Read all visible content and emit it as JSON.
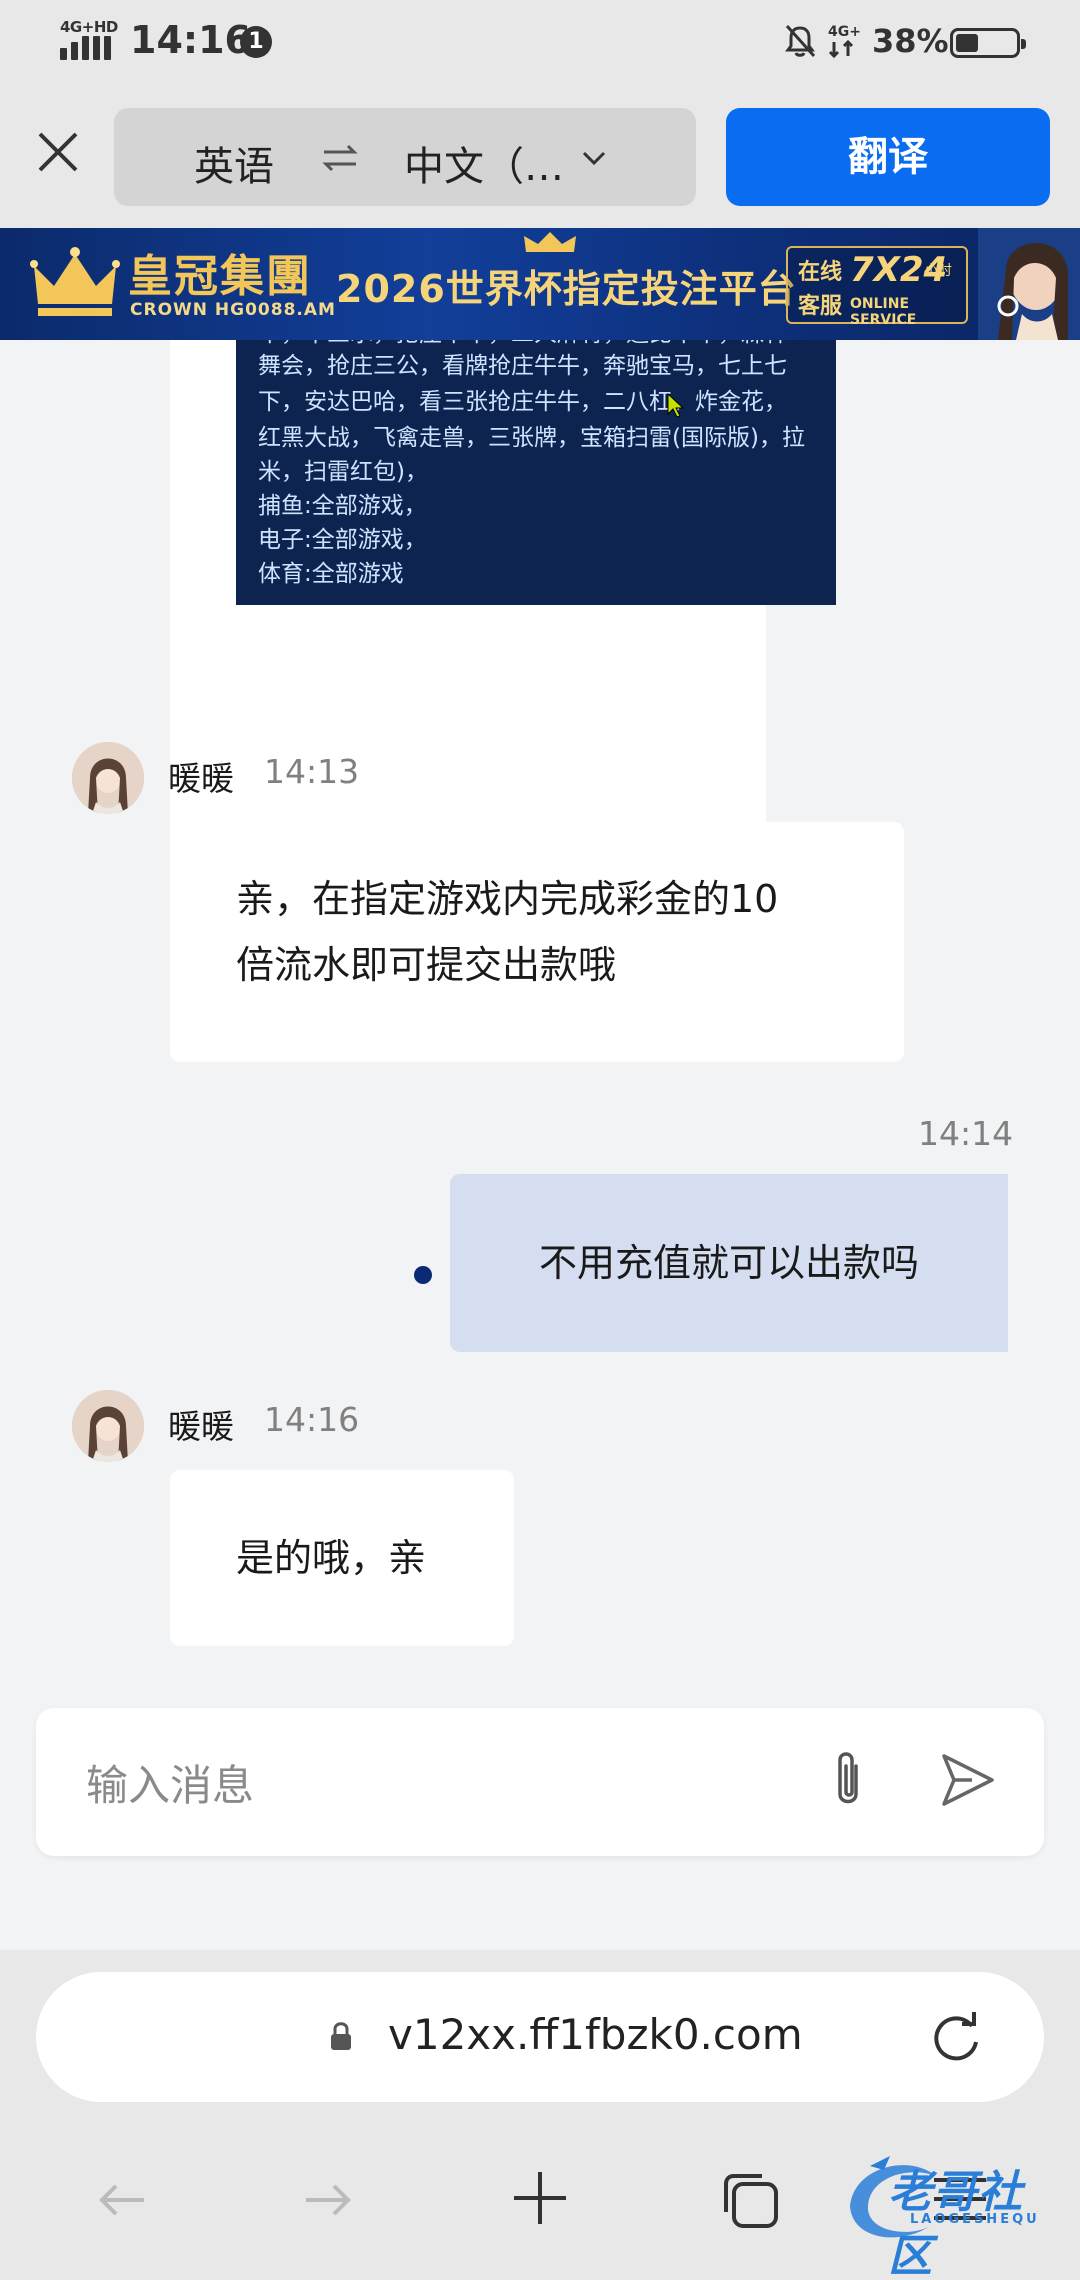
{
  "status_bar": {
    "network_type": "4G+HD",
    "time": "14:16",
    "notification_count": "1",
    "mobile_data": "4G+",
    "battery_percent": "38%",
    "battery_level": 0.38
  },
  "translate_bar": {
    "source_language": "英语",
    "target_language": "中文（…",
    "translate_button": "翻译"
  },
  "ad_banner": {
    "brand": "皇冠集團",
    "brand_sub": "CROWN HG0088.AM",
    "headline": "2026世界杯指定投注平台",
    "service_line1": "在线",
    "service_line2": "客服",
    "service_hours": "7X24",
    "service_unit": "小时",
    "service_label": "ONLINE SERVICE"
  },
  "image_message": {
    "lines": [
      "牛，十三水，抢庄牛牛，二人麻将，通比牛牛，森林",
      "舞会，抢庄三公，看牌抢庄牛牛，奔驰宝马，七上七",
      "下，安达巴哈，看三张抢庄牛牛，二八杠，炸金花，",
      "红黑大战，飞禽走兽，三张牌，宝箱扫雷(国际版)，拉",
      "米，扫雷红包)，",
      "捕鱼:全部游戏，",
      "电子:全部游戏，",
      "体育:全部游戏"
    ]
  },
  "messages": [
    {
      "sender": "暖暖",
      "time": "14:13",
      "text_lines": [
        "亲，在指定游戏内完成彩金的10",
        "倍流水即可提交出款哦"
      ]
    },
    {
      "time": "14:14",
      "text": "不用充值就可以出款吗"
    },
    {
      "sender": "暖暖",
      "time": "14:16",
      "text": "是的哦，亲"
    }
  ],
  "composer": {
    "placeholder": "输入消息"
  },
  "browser": {
    "url": "v12xx.ff1fbzk0.com"
  },
  "watermark": {
    "text": "老哥社区",
    "sub": "LAOGESHEQU"
  }
}
